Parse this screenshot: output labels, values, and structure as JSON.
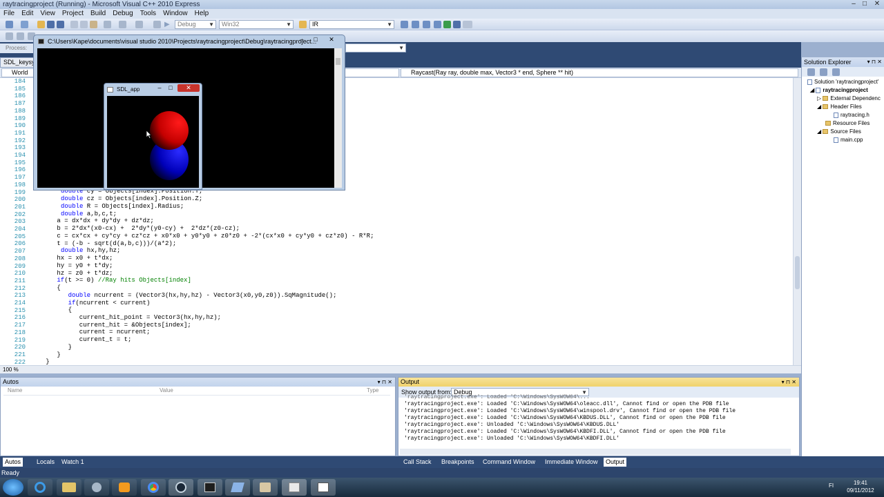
{
  "window": {
    "title": "raytracingproject (Running) - Microsoft Visual C++ 2010 Express"
  },
  "menu": [
    "File",
    "Edit",
    "View",
    "Project",
    "Build",
    "Debug",
    "Tools",
    "Window",
    "Help"
  ],
  "toolbar": {
    "config": "Debug",
    "platform": "Win32",
    "find": "IR",
    "process_label": "Process:"
  },
  "file_tab": "SDL_keysym",
  "nav": {
    "scope": "World",
    "method": "Raycast(Ray ray, double max, Vector3 * end, Sphere ** hit)"
  },
  "editor": {
    "line_numbers": [
      "184",
      "185",
      "186",
      "187",
      "188",
      "189",
      "190",
      "191",
      "192",
      "193",
      "194",
      "195",
      "196",
      "197",
      "198",
      "199",
      "200",
      "201",
      "202",
      "203",
      "204",
      "205",
      "206",
      "207",
      "208",
      "209",
      "210",
      "211",
      "212",
      "213",
      "214",
      "215",
      "216",
      "217",
      "218",
      "219",
      "220",
      "221",
      "222"
    ],
    "zoom": "100 %"
  },
  "console": {
    "title": "C:\\Users\\Kape\\documents\\visual studio 2010\\Projects\\raytracingproject\\Debug\\raytracingproject..."
  },
  "sdl": {
    "title": "SDL_app"
  },
  "solution_explorer": {
    "title": "Solution Explorer",
    "items": [
      "Solution 'raytracingproject'",
      "raytracingproject",
      "External Dependenc",
      "Header Files",
      "raytracing.h",
      "Resource Files",
      "Source Files",
      "main.cpp"
    ]
  },
  "autos": {
    "title": "Autos",
    "columns": [
      "Name",
      "Value",
      "Type"
    ]
  },
  "output": {
    "title": "Output",
    "show_from_label": "Show output from:",
    "show_from_value": "Debug",
    "lines": [
      "'raytracingproject.exe': Loaded 'C:\\Windows\\SysWOW64\\oleacc.dll', Cannot find or open the PDB file",
      "'raytracingproject.exe': Loaded 'C:\\Windows\\SysWOW64\\winspool.drv', Cannot find or open the PDB file",
      "'raytracingproject.exe': Loaded 'C:\\Windows\\SysWOW64\\KBDUS.DLL', Cannot find or open the PDB file",
      "'raytracingproject.exe': Unloaded 'C:\\Windows\\SysWOW64\\KBDUS.DLL'",
      "'raytracingproject.exe': Loaded 'C:\\Windows\\SysWOW64\\KBDFI.DLL', Cannot find or open the PDB file",
      "'raytracingproject.exe': Unloaded 'C:\\Windows\\SysWOW64\\KBDFI.DLL'"
    ]
  },
  "bottom_tabs_left": [
    "Autos",
    "Locals",
    "Watch 1"
  ],
  "bottom_tabs_right": [
    "Call Stack",
    "Breakpoints",
    "Command Window",
    "Immediate Window",
    "Output"
  ],
  "status": "Ready",
  "tray": {
    "lang": "FI",
    "time": "19:41",
    "date": "09/11/2012"
  }
}
